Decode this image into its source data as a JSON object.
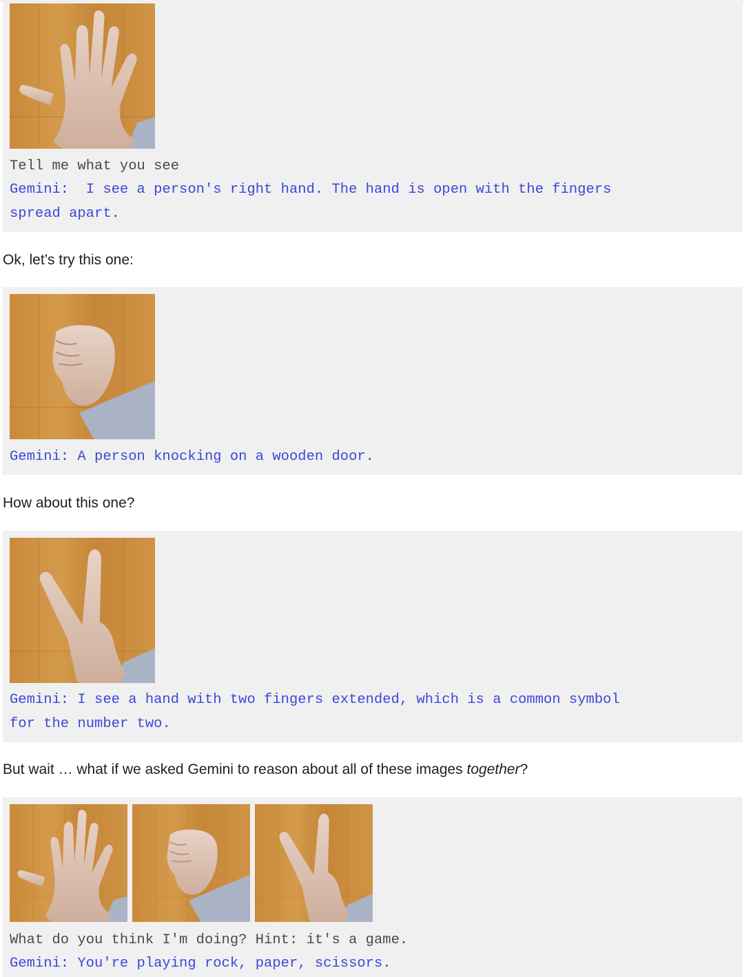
{
  "colors": {
    "block_bg": "#f0f0f0",
    "gemini_text": "#3d47d9",
    "user_text": "#4a4a4a",
    "wood": "#cc8f3e"
  },
  "block1": {
    "image": "open-hand-photo",
    "prompt": "Tell me what you see",
    "reply_line1": "Gemini:  I see a person's right hand. The hand is open with the fingers",
    "reply_line2": "spread apart."
  },
  "prose1": "Ok, let’s try this one:",
  "block2": {
    "image": "fist-photo",
    "reply": "Gemini: A person knocking on a wooden door."
  },
  "prose2": "How about this one?",
  "block3": {
    "image": "two-fingers-photo",
    "reply_line1": "Gemini: I see a hand with two fingers extended, which is a common symbol",
    "reply_line2": "for the number two."
  },
  "prose3": {
    "before": "But wait … what if we asked Gemini to reason about all of these images ",
    "emphasis": "together",
    "after": "?"
  },
  "block4": {
    "images": [
      "open-hand-photo",
      "fist-photo",
      "two-fingers-photo"
    ],
    "prompt": "What do you think I'm doing? Hint: it's a game.",
    "reply": "Gemini: You're playing rock, paper, scissors."
  }
}
